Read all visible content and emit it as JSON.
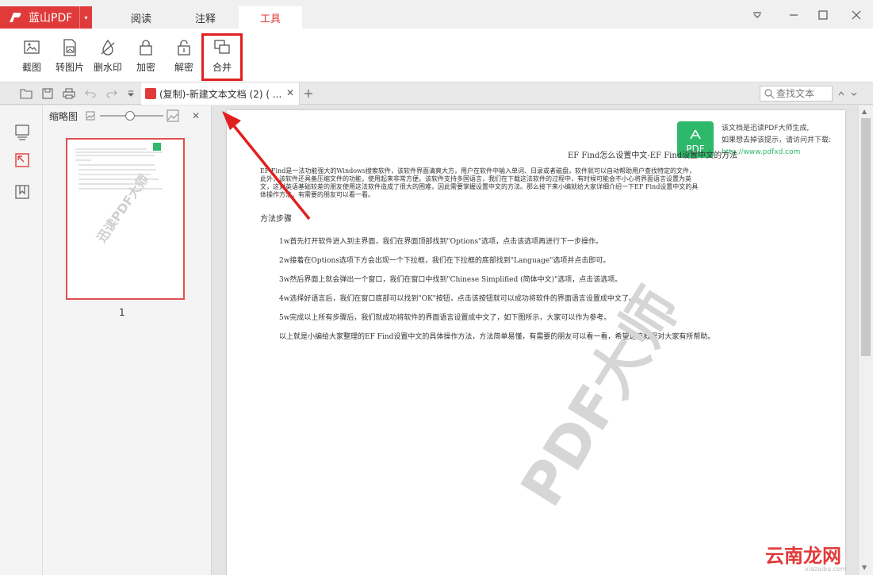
{
  "app": {
    "logo_text": "蓝山PDF",
    "accent": "#e03a3a"
  },
  "tabs": [
    {
      "label": "阅读"
    },
    {
      "label": "注释"
    },
    {
      "label": "工具"
    }
  ],
  "ribbon": {
    "tools": [
      {
        "label": "截图",
        "icon": "screenshot-icon"
      },
      {
        "label": "转图片",
        "icon": "to-image-icon"
      },
      {
        "label": "删水印",
        "icon": "remove-watermark-icon"
      },
      {
        "label": "加密",
        "icon": "lock-icon"
      },
      {
        "label": "解密",
        "icon": "unlock-icon"
      },
      {
        "label": "合并",
        "icon": "merge-icon"
      }
    ]
  },
  "document_tab": {
    "title": "(复制)-新建文本文档 (2) ( ..."
  },
  "search": {
    "placeholder": "查找文本"
  },
  "thumbnail_panel": {
    "title": "缩略图",
    "page_number": "1"
  },
  "page": {
    "watermark_badge": "PDF",
    "watermark_line1": "该文档是迅读PDF大师生成,",
    "watermark_line2": "如果想去掉该提示，请访问并下载:",
    "watermark_url": "http://www.pdfxd.com",
    "title": "EF Find怎么设置中文-EF Find设置中文的方法",
    "intro": "EF Find是一法功能强大的Windows搜索软件，该软件界面清爽大方，用户在软件中输入单词、日录或者磁盘，软件就可以自动帮助用户查找特定的文件，此外，该软件还具备压缩文件的功能，使用起来非常方便。该软件支持多国语言，我们在下载这法软件的过程中，有时候可能会不小心将界面语言设置为英文，这对英语基础较差的朋友使用这法软件造成了很大的困难，因此需要掌握设置中文的方法。那么接下来小编就给大家详细介绍一下EF Find设置中文的具体操作方法，有需要的朋友可以看一看。",
    "heading": "方法步骤",
    "steps": [
      "1w首先打开软件进入到主界面，我们在界面顶部找到\"Options\"选项，点击该选项再进行下一步操作。",
      "2w接着在Options选项下方会出现一个下拉框，我们在下拉框的底部找到\"Language\"选项并点击即可。",
      "3w然后界面上就会弹出一个窗口，我们在窗口中找到\"Chinese Simplified (简体中文)\"选项，点击该选项。",
      "4w选择好语言后，我们在窗口底部可以找到\"OK\"按钮，点击该按钮就可以成功将软件的界面语言设置成中文了。",
      "5w完成以上所有步骤后，我们就成功将软件的界面语言设置成中文了，如下图所示，大家可以作为参考。",
      "以上就是小编给大家整理的EF Find设置中文的具体操作方法，方法简单易懂，有需要的朋友可以看一看，希望这篇教程对大家有所帮助。"
    ],
    "big_watermark": "PDF大师"
  },
  "thumb_watermark": "迅读PDF大师",
  "corner_watermark": {
    "big": "云南龙网",
    "small": "xiazaiba.com"
  }
}
